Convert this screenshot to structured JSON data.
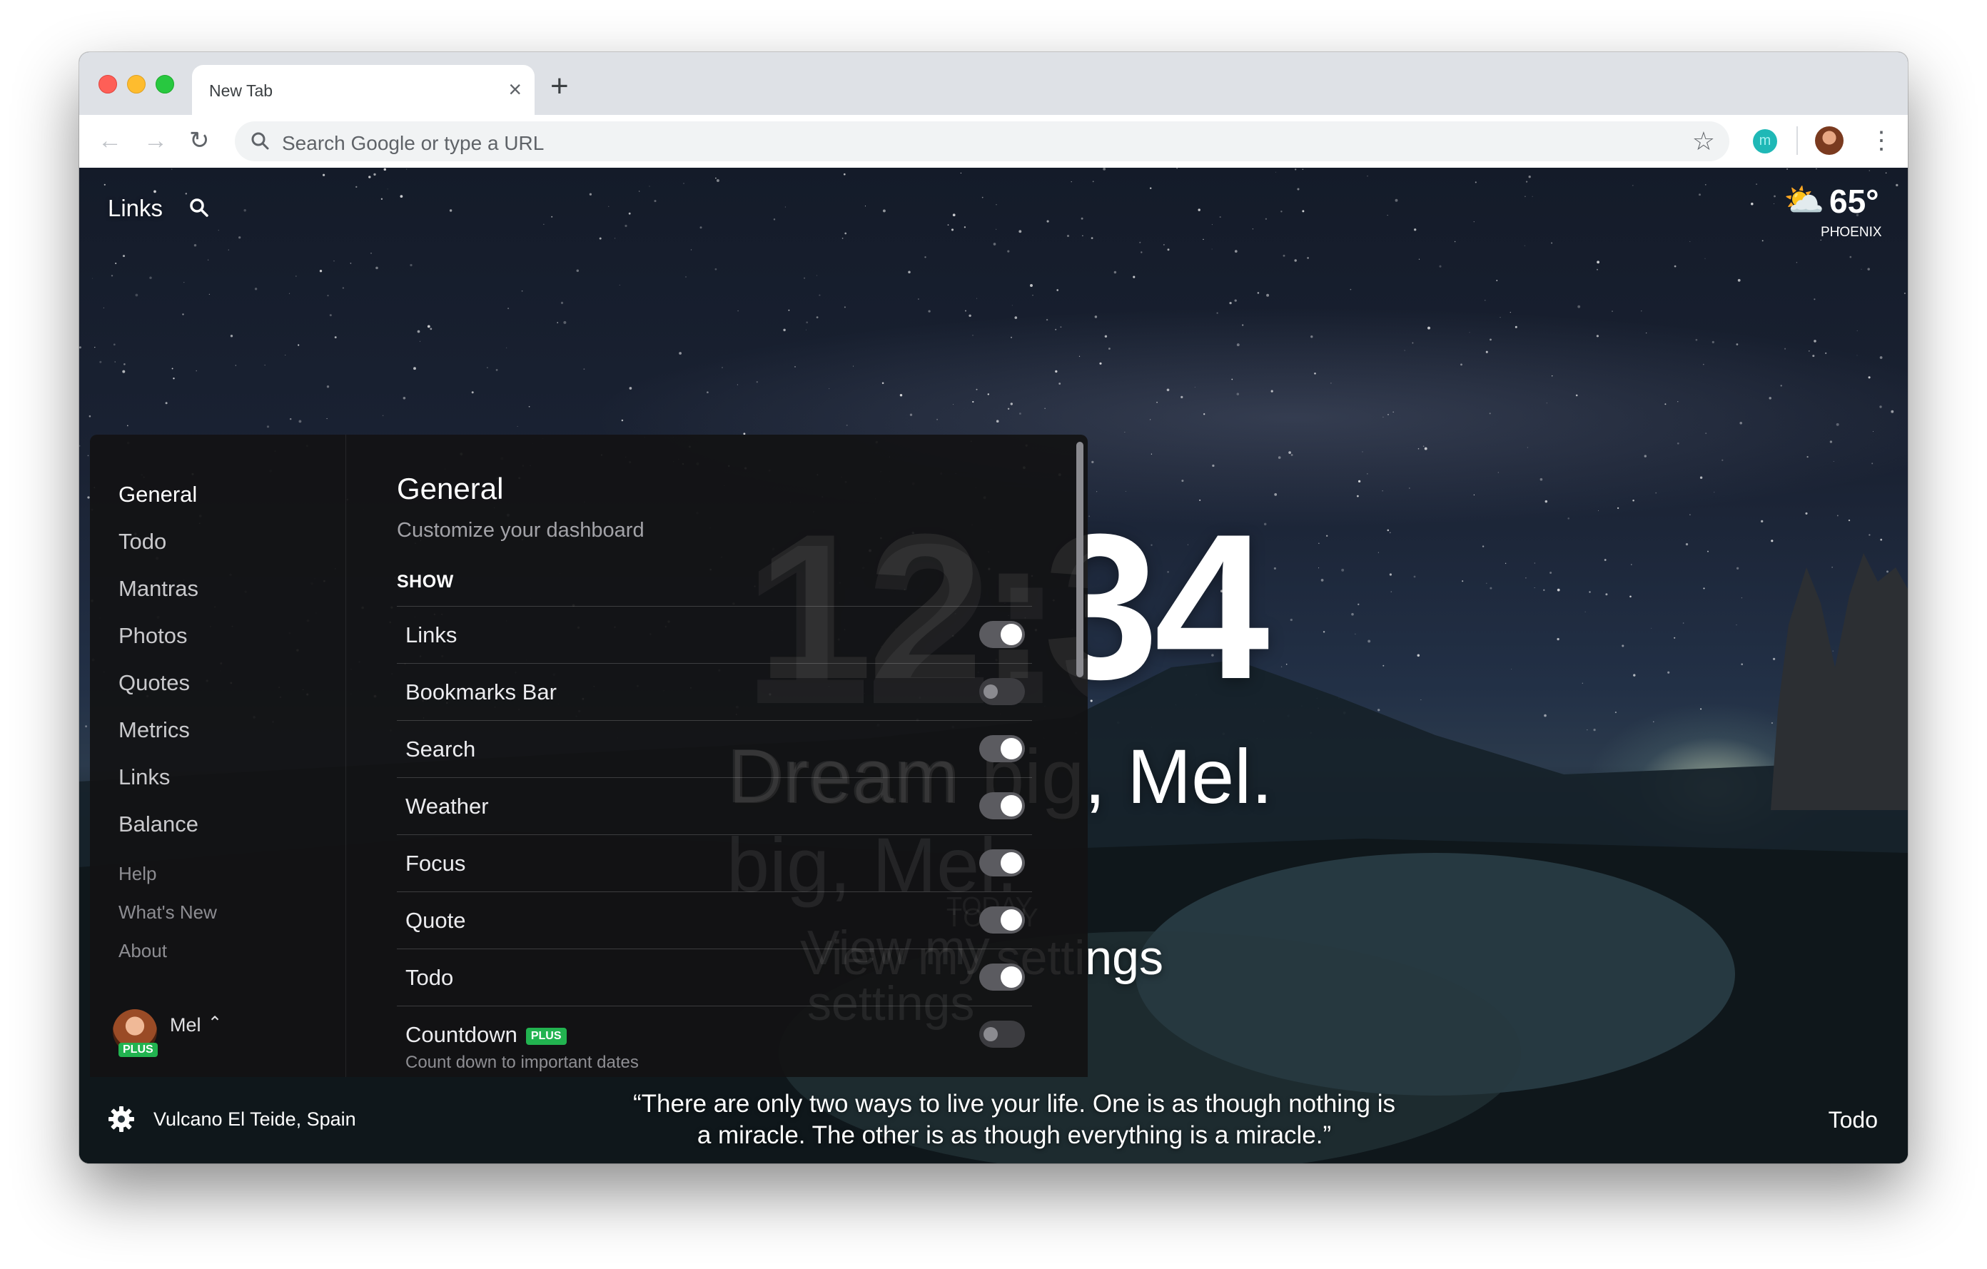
{
  "browser": {
    "tab_title": "New Tab",
    "tab_close": "×",
    "new_tab": "+",
    "address_placeholder": "Search Google or type a URL",
    "extension_letter": "m"
  },
  "dashboard": {
    "links_label": "Links",
    "weather": {
      "temp": "65°",
      "location": "PHOENIX"
    },
    "clock": "12:34",
    "greeting": "Dream big, Mel.",
    "focus_label": "TODAY",
    "focus_text": "View my settings",
    "photo_location": "Vulcano El Teide, Spain",
    "quote_line1": "“There are only two ways to live your life. One is as though nothing is",
    "quote_line2": "a miracle. The other is as though everything is a miracle.”",
    "todo_label": "Todo"
  },
  "settings": {
    "nav": [
      "General",
      "Todo",
      "Mantras",
      "Photos",
      "Quotes",
      "Metrics",
      "Links",
      "Balance"
    ],
    "secondary_nav": [
      "Help",
      "What's New",
      "About"
    ],
    "user": {
      "name": "Mel",
      "plan_badge": "PLUS"
    },
    "title": "General",
    "subtitle": "Customize your dashboard",
    "section_header": "SHOW",
    "toggles": [
      {
        "label": "Links",
        "on": true
      },
      {
        "label": "Bookmarks Bar",
        "on": false
      },
      {
        "label": "Search",
        "on": true
      },
      {
        "label": "Weather",
        "on": true
      },
      {
        "label": "Focus",
        "on": true
      },
      {
        "label": "Quote",
        "on": true
      },
      {
        "label": "Todo",
        "on": true
      },
      {
        "label": "Countdown",
        "on": false,
        "badge": "PLUS",
        "description": "Count down to important dates"
      }
    ]
  },
  "colors": {
    "accent_green": "#22b350",
    "panel_bg": "#121214"
  }
}
